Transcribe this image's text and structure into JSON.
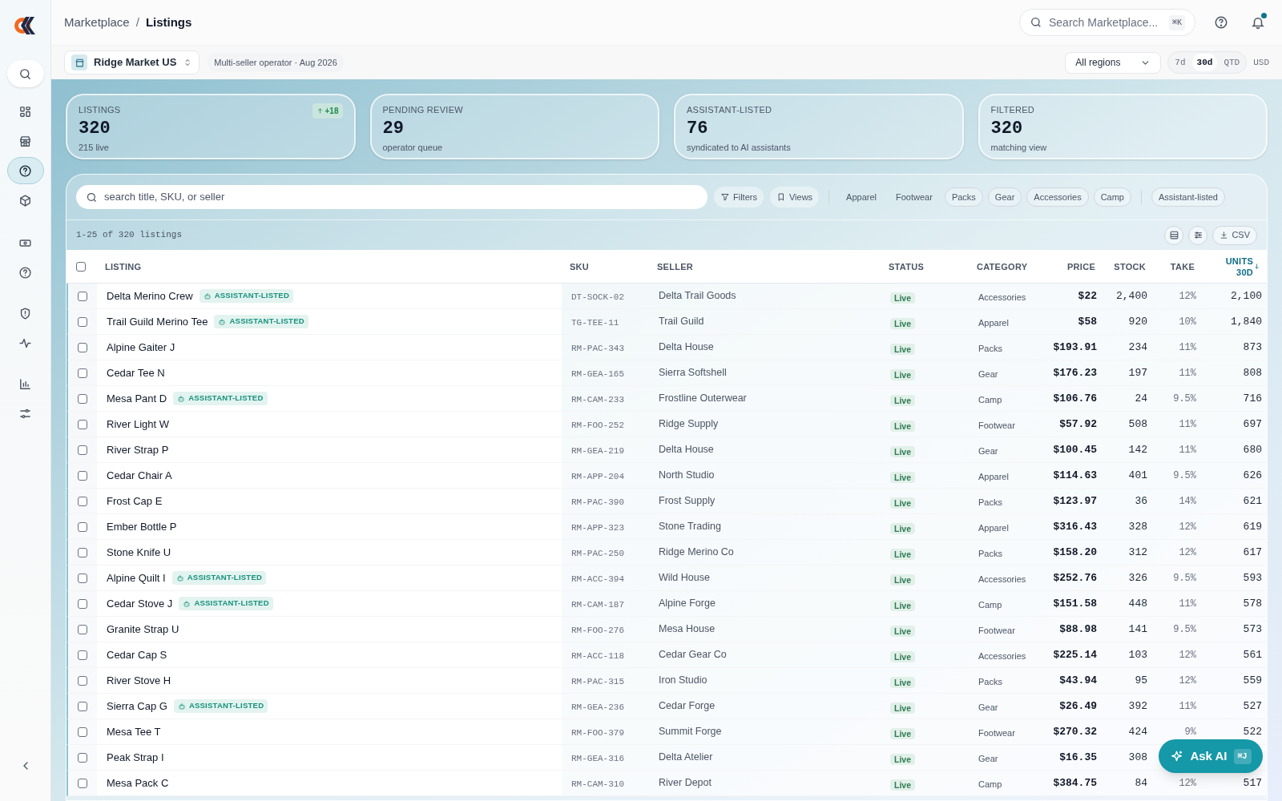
{
  "sidebar": {
    "items": [
      {
        "selected": false
      },
      {
        "selected": false
      },
      {
        "selected": false
      },
      {
        "selected": true
      },
      {
        "selected": false
      },
      {
        "selected": false
      },
      {
        "selected": false
      },
      {
        "selected": false
      },
      {
        "selected": false
      },
      {
        "selected": false
      },
      {
        "selected": false
      }
    ]
  },
  "breadcrumb": {
    "parent": "Marketplace",
    "separator": "/",
    "current": "Listings"
  },
  "search": {
    "placeholder": "Search Marketplace...",
    "shortcut": "⌘K"
  },
  "notifications": {
    "unread": true
  },
  "store_switcher": {
    "label": "Ridge Market US"
  },
  "context_chip": "Multi-seller operator · Aug 2026",
  "region_select": {
    "value": "All regions"
  },
  "periods": [
    {
      "label": "7d",
      "selected": false
    },
    {
      "label": "30d",
      "selected": true
    },
    {
      "label": "QTD",
      "selected": false
    }
  ],
  "currency": "USD",
  "stats": [
    {
      "label": "LISTINGS",
      "value": "320",
      "caption": "215 live",
      "delta": "+18"
    },
    {
      "label": "PENDING REVIEW",
      "value": "29",
      "caption": "operator queue"
    },
    {
      "label": "ASSISTANT-LISTED",
      "value": "76",
      "caption": "syndicated to AI assistants"
    },
    {
      "label": "FILTERED",
      "value": "320",
      "caption": "matching view"
    }
  ],
  "filter_bar": {
    "placeholder": "search title, SKU, or seller",
    "filters": "Filters",
    "views": "Views",
    "chips": [
      {
        "label": "Apparel",
        "selected": false
      },
      {
        "label": "Footwear",
        "selected": false
      },
      {
        "label": "Packs",
        "selected": true
      },
      {
        "label": "Gear",
        "selected": true
      },
      {
        "label": "Accessories",
        "selected": true
      },
      {
        "label": "Camp",
        "selected": true
      }
    ],
    "assistant_chip": "Assistant-listed"
  },
  "count": "1-25 of 320 listings",
  "export": "CSV",
  "table": {
    "all_checked": false,
    "columns": [
      {
        "label": "LISTING",
        "sorted": false
      },
      {
        "label": "SKU",
        "sorted": false
      },
      {
        "label": "SELLER",
        "sorted": false
      },
      {
        "label": "STATUS",
        "sorted": false
      },
      {
        "label": "CATEGORY",
        "sorted": false
      },
      {
        "label": "PRICE",
        "sorted": false
      },
      {
        "label": "STOCK",
        "sorted": false
      },
      {
        "label": "TAKE",
        "sorted": false
      },
      {
        "label": "UNITS 30D",
        "sorted": true
      }
    ],
    "rows": [
      {
        "checked": false,
        "listing": "Delta Merino Crew",
        "badge": "ASSISTANT-LISTED",
        "sku": "DT-SOCK-02",
        "seller": "Delta Trail Goods",
        "status": "Live",
        "category": "Accessories",
        "price": "$22",
        "stock": "2,400",
        "take": "12%",
        "units": "2,100"
      },
      {
        "checked": false,
        "listing": "Trail Guild Merino Tee",
        "badge": "ASSISTANT-LISTED",
        "sku": "TG-TEE-11",
        "seller": "Trail Guild",
        "status": "Live",
        "category": "Apparel",
        "price": "$58",
        "stock": "920",
        "take": "10%",
        "units": "1,840"
      },
      {
        "checked": false,
        "listing": "Alpine Gaiter J",
        "sku": "RM-PAC-343",
        "seller": "Delta House",
        "status": "Live",
        "category": "Packs",
        "price": "$193.91",
        "stock": "234",
        "take": "11%",
        "units": "873"
      },
      {
        "checked": false,
        "listing": "Cedar Tee N",
        "sku": "RM-GEA-165",
        "seller": "Sierra Softshell",
        "status": "Live",
        "category": "Gear",
        "price": "$176.23",
        "stock": "197",
        "take": "11%",
        "units": "808"
      },
      {
        "checked": false,
        "listing": "Mesa Pant D",
        "badge": "ASSISTANT-LISTED",
        "sku": "RM-CAM-233",
        "seller": "Frostline Outerwear",
        "status": "Live",
        "category": "Camp",
        "price": "$106.76",
        "stock": "24",
        "take": "9.5%",
        "units": "716"
      },
      {
        "checked": false,
        "listing": "River Light W",
        "sku": "RM-FOO-252",
        "seller": "Ridge Supply",
        "status": "Live",
        "category": "Footwear",
        "price": "$57.92",
        "stock": "508",
        "take": "11%",
        "units": "697"
      },
      {
        "checked": false,
        "listing": "River Strap P",
        "sku": "RM-GEA-219",
        "seller": "Delta House",
        "status": "Live",
        "category": "Gear",
        "price": "$100.45",
        "stock": "142",
        "take": "11%",
        "units": "680"
      },
      {
        "checked": false,
        "listing": "Cedar Chair A",
        "sku": "RM-APP-204",
        "seller": "North Studio",
        "status": "Live",
        "category": "Apparel",
        "price": "$114.63",
        "stock": "401",
        "take": "9.5%",
        "units": "626"
      },
      {
        "checked": false,
        "listing": "Frost Cap E",
        "sku": "RM-PAC-390",
        "seller": "Frost Supply",
        "status": "Live",
        "category": "Packs",
        "price": "$123.97",
        "stock": "36",
        "take": "14%",
        "units": "621"
      },
      {
        "checked": false,
        "listing": "Ember Bottle P",
        "sku": "RM-APP-323",
        "seller": "Stone Trading",
        "status": "Live",
        "category": "Apparel",
        "price": "$316.43",
        "stock": "328",
        "take": "12%",
        "units": "619"
      },
      {
        "checked": false,
        "listing": "Stone Knife U",
        "sku": "RM-PAC-250",
        "seller": "Ridge Merino Co",
        "status": "Live",
        "category": "Packs",
        "price": "$158.20",
        "stock": "312",
        "take": "12%",
        "units": "617"
      },
      {
        "checked": false,
        "listing": "Alpine Quilt I",
        "badge": "ASSISTANT-LISTED",
        "sku": "RM-ACC-394",
        "seller": "Wild House",
        "status": "Live",
        "category": "Accessories",
        "price": "$252.76",
        "stock": "326",
        "take": "9.5%",
        "units": "593"
      },
      {
        "checked": false,
        "listing": "Cedar Stove J",
        "badge": "ASSISTANT-LISTED",
        "sku": "RM-CAM-187",
        "seller": "Alpine Forge",
        "status": "Live",
        "category": "Camp",
        "price": "$151.58",
        "stock": "448",
        "take": "11%",
        "units": "578"
      },
      {
        "checked": false,
        "listing": "Granite Strap U",
        "sku": "RM-FOO-276",
        "seller": "Mesa House",
        "status": "Live",
        "category": "Footwear",
        "price": "$88.98",
        "stock": "141",
        "take": "9.5%",
        "units": "573"
      },
      {
        "checked": false,
        "listing": "Cedar Cap S",
        "sku": "RM-ACC-118",
        "seller": "Cedar Gear Co",
        "status": "Live",
        "category": "Accessories",
        "price": "$225.14",
        "stock": "103",
        "take": "12%",
        "units": "561"
      },
      {
        "checked": false,
        "listing": "River Stove H",
        "sku": "RM-PAC-315",
        "seller": "Iron Studio",
        "status": "Live",
        "category": "Packs",
        "price": "$43.94",
        "stock": "95",
        "take": "12%",
        "units": "559"
      },
      {
        "checked": false,
        "listing": "Sierra Cap G",
        "badge": "ASSISTANT-LISTED",
        "sku": "RM-GEA-236",
        "seller": "Cedar Forge",
        "status": "Live",
        "category": "Gear",
        "price": "$26.49",
        "stock": "392",
        "take": "11%",
        "units": "527"
      },
      {
        "checked": false,
        "listing": "Mesa Tee T",
        "sku": "RM-FOO-379",
        "seller": "Summit Forge",
        "status": "Live",
        "category": "Footwear",
        "price": "$270.32",
        "stock": "424",
        "take": "9%",
        "units": "522"
      },
      {
        "checked": false,
        "listing": "Peak Strap I",
        "sku": "RM-GEA-316",
        "seller": "Delta Atelier",
        "status": "Live",
        "category": "Gear",
        "price": "$16.35",
        "stock": "308"
      },
      {
        "checked": false,
        "listing": "Mesa Pack C",
        "sku": "RM-CAM-310",
        "seller": "River Depot",
        "status": "Live",
        "category": "Camp",
        "price": "$384.75",
        "stock": "84",
        "take": "12%",
        "units": "517"
      }
    ]
  },
  "ask_ai": {
    "label": "Ask AI",
    "shortcut": "⌘J"
  }
}
